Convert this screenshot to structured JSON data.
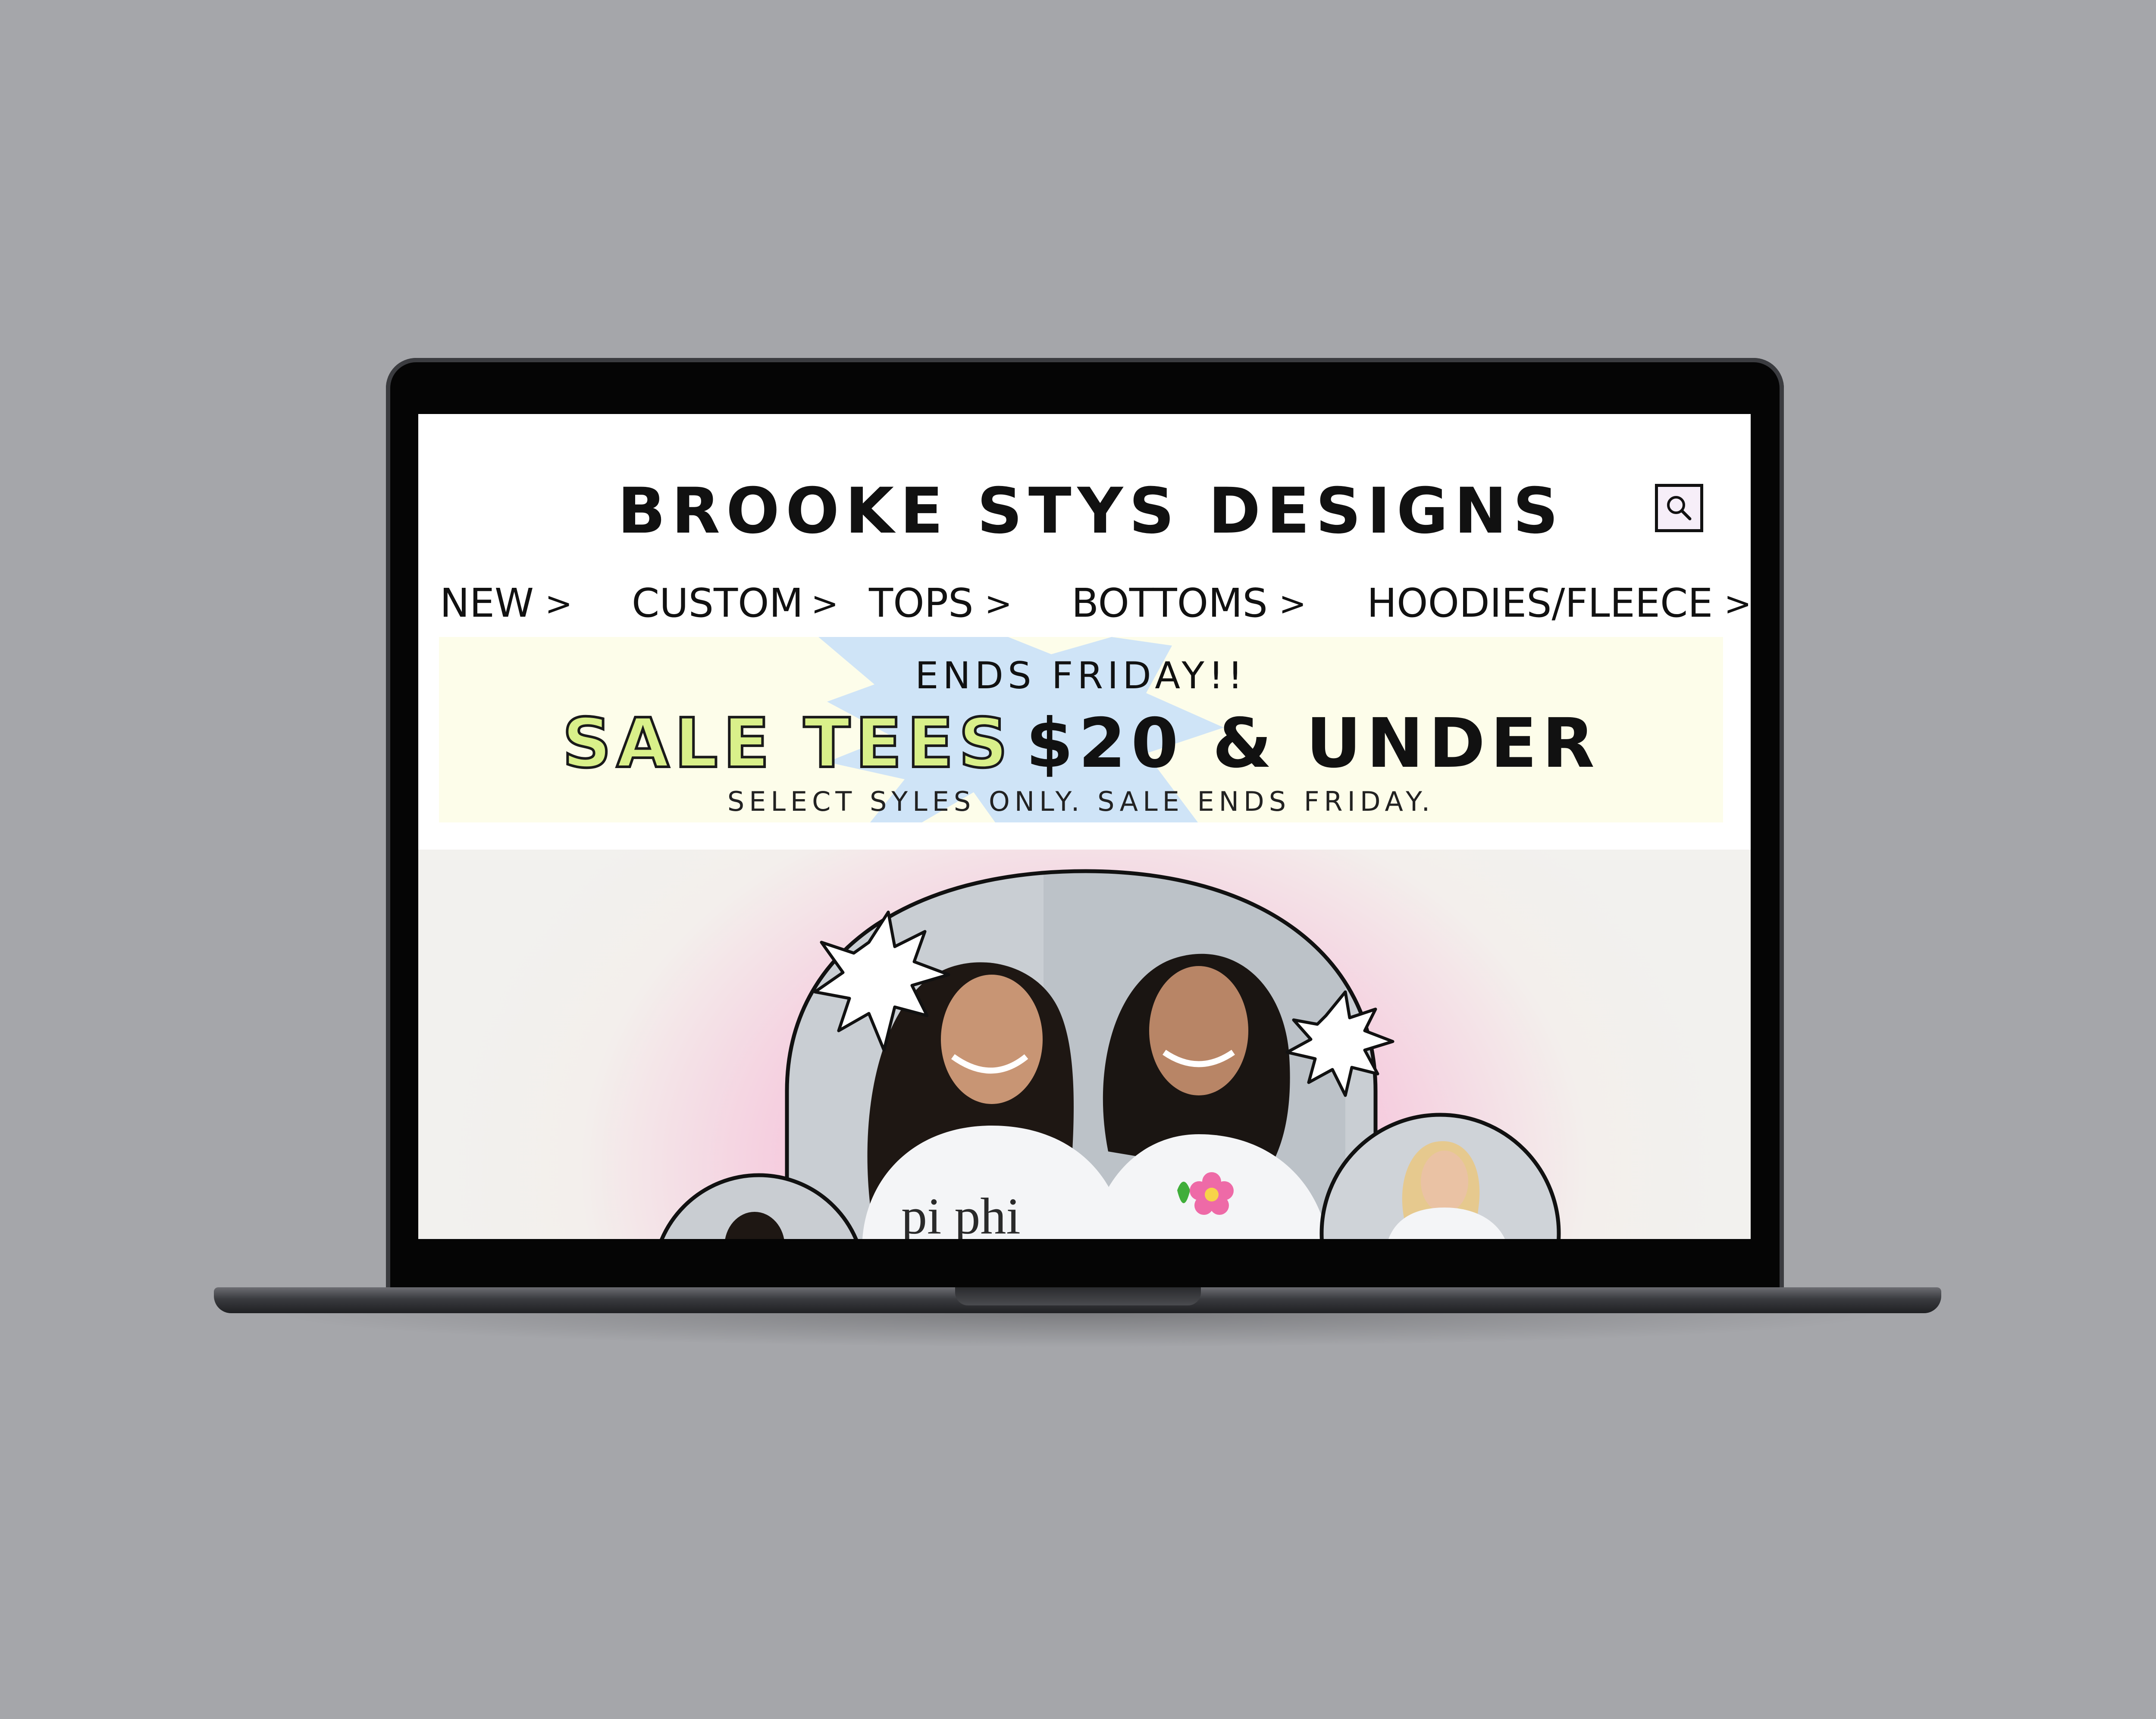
{
  "brand": {
    "name": "BROOKE STYS DESIGNS"
  },
  "nav": {
    "items": [
      {
        "label": "NEW",
        "chevron": ">"
      },
      {
        "label": "CUSTOM",
        "chevron": ">"
      },
      {
        "label": "TOPS",
        "chevron": ">"
      },
      {
        "label": "BOTTOMS",
        "chevron": ">"
      },
      {
        "label": "HOODIES/FLEECE",
        "chevron": ">"
      }
    ]
  },
  "banner": {
    "ends": "ENDS FRIDAY!!",
    "sale_highlight": "SALE TEES",
    "sale_rest": "$20 & UNDER",
    "fine_print": "SELECT SYLES ONLY. SALE ENDS FRIDAY."
  },
  "hero": {
    "shirt_text": "pi phi"
  },
  "icons": {
    "search": "search-icon",
    "starburst": "starburst-icon",
    "flower": "flower-icon"
  },
  "colors": {
    "banner_bg": "#fdfdea",
    "banner_burst": "#cfe4f7",
    "sale_green": "#d9f08a",
    "hero_pink": "#f4b3d2",
    "device_bg": "#a5a6aa"
  }
}
